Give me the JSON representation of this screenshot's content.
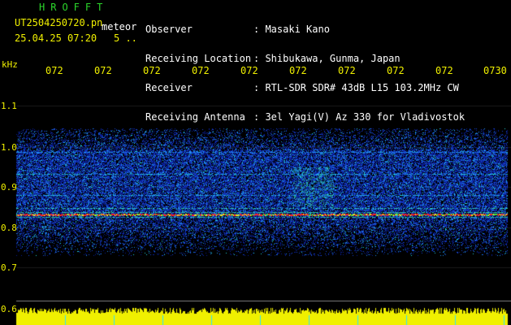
{
  "header": {
    "brand": "HROFFT",
    "filename": "UT2504250720.pn",
    "filename_suffix": "meteor",
    "date_time": "25.04.25 07:20",
    "meta": "5 .."
  },
  "info": {
    "labels": [
      "Observer",
      "Receiving Location",
      "Receiver",
      "Receiving Antenna"
    ],
    "values": [
      ": Masaki Kano",
      ": Shibukawa, Gunma, Japan",
      ": RTL-SDR SDR# 43dB L15 103.2MHz CW",
      ": 3el Yagi(V) Az 330 for Vladivostok"
    ]
  },
  "axes": {
    "unit": "kHz",
    "y_ticks": [
      "1.1",
      "1.0",
      "0.9",
      "0.8",
      "0.7",
      "0.6"
    ],
    "x_ticks": [
      "072",
      "072",
      "072",
      "072",
      "072",
      "072",
      "072",
      "072",
      "072",
      "0730"
    ]
  },
  "colors": {
    "text_yellow": "#f0f000",
    "text_white": "#ffffff",
    "brand_green": "#2bd62b",
    "background": "#000000",
    "signal_red": "#ff2020",
    "noise_blue": "#1030c0",
    "level_yellow": "#f0f000"
  }
}
